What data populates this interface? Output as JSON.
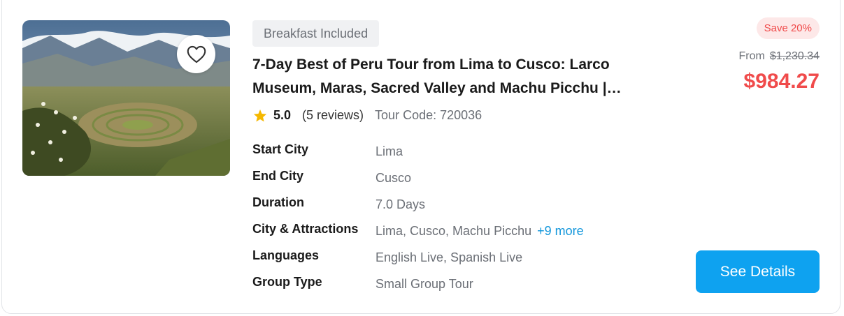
{
  "listing": {
    "badge": "Breakfast Included",
    "title": "7-Day Best of Peru Tour from Lima to Cusco: Larco Museum, Maras, Sacred Valley and Machu Picchu |…",
    "rating": "5.0",
    "reviews": "(5 reviews)",
    "tour_code": "Tour Code: 720036",
    "details": [
      {
        "label": "Start City",
        "value": "Lima"
      },
      {
        "label": "End City",
        "value": "Cusco"
      },
      {
        "label": "Duration",
        "value": "7.0 Days"
      },
      {
        "label": "City & Attractions",
        "value": "Lima, Cusco, Machu Picchu",
        "more": "+9 more"
      },
      {
        "label": "Languages",
        "value": "English Live, Spanish Live"
      },
      {
        "label": "Group Type",
        "value": "Small Group Tour"
      }
    ]
  },
  "pricing": {
    "save": "Save 20%",
    "from_label": "From",
    "original_price": "$1,230.34",
    "price": "$984.27"
  },
  "actions": {
    "see_details": "See Details"
  },
  "icons": {
    "favorite": "heart-outline-icon",
    "rating": "star-icon"
  },
  "colors": {
    "accent": "#0ea2f0",
    "price": "#f04b4b",
    "star": "#f5b800",
    "link": "#1296db"
  }
}
